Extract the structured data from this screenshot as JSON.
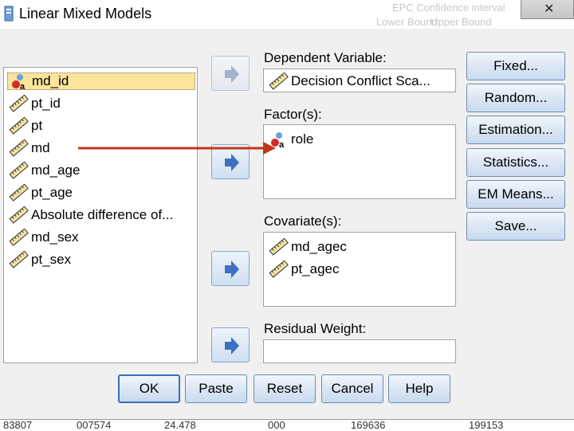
{
  "window": {
    "title": "Linear Mixed Models",
    "close_glyph": "✕"
  },
  "background_text": [
    "EPC Confidence interval",
    "Lower Bound",
    "Upper Bound"
  ],
  "variables": [
    {
      "name": "md_id",
      "icon": "nominal-icon"
    },
    {
      "name": "pt_id",
      "icon": "scale-ruler-icon"
    },
    {
      "name": "pt",
      "icon": "scale-ruler-icon"
    },
    {
      "name": "md",
      "icon": "scale-ruler-icon"
    },
    {
      "name": "md_age",
      "icon": "scale-ruler-icon"
    },
    {
      "name": "pt_age",
      "icon": "scale-ruler-icon"
    },
    {
      "name": "Absolute difference of...",
      "icon": "scale-ruler-icon"
    },
    {
      "name": "md_sex",
      "icon": "scale-ruler-icon"
    },
    {
      "name": "pt_sex",
      "icon": "scale-ruler-icon"
    }
  ],
  "dependent": {
    "label": "Dependent Variable:",
    "value": "Decision Conflict Sca..."
  },
  "factors": {
    "label": "Factor(s):",
    "items": [
      "role"
    ]
  },
  "covariates": {
    "label": "Covariate(s):",
    "items": [
      "md_agec",
      "pt_agec"
    ]
  },
  "residual_weight": {
    "label": "Residual Weight:",
    "value": ""
  },
  "side_buttons": [
    "Fixed...",
    "Random...",
    "Estimation...",
    "Statistics...",
    "EM Means...",
    "Save..."
  ],
  "bottom_buttons": [
    "OK",
    "Paste",
    "Reset",
    "Cancel",
    "Help"
  ],
  "status_values": [
    "83807",
    "007574",
    "24.478",
    "000",
    "169636",
    "199153"
  ],
  "colors": {
    "selection": "#fbe49b",
    "annotation_arrow": "#c0391b",
    "button_arrow": "#3d6fc4"
  }
}
